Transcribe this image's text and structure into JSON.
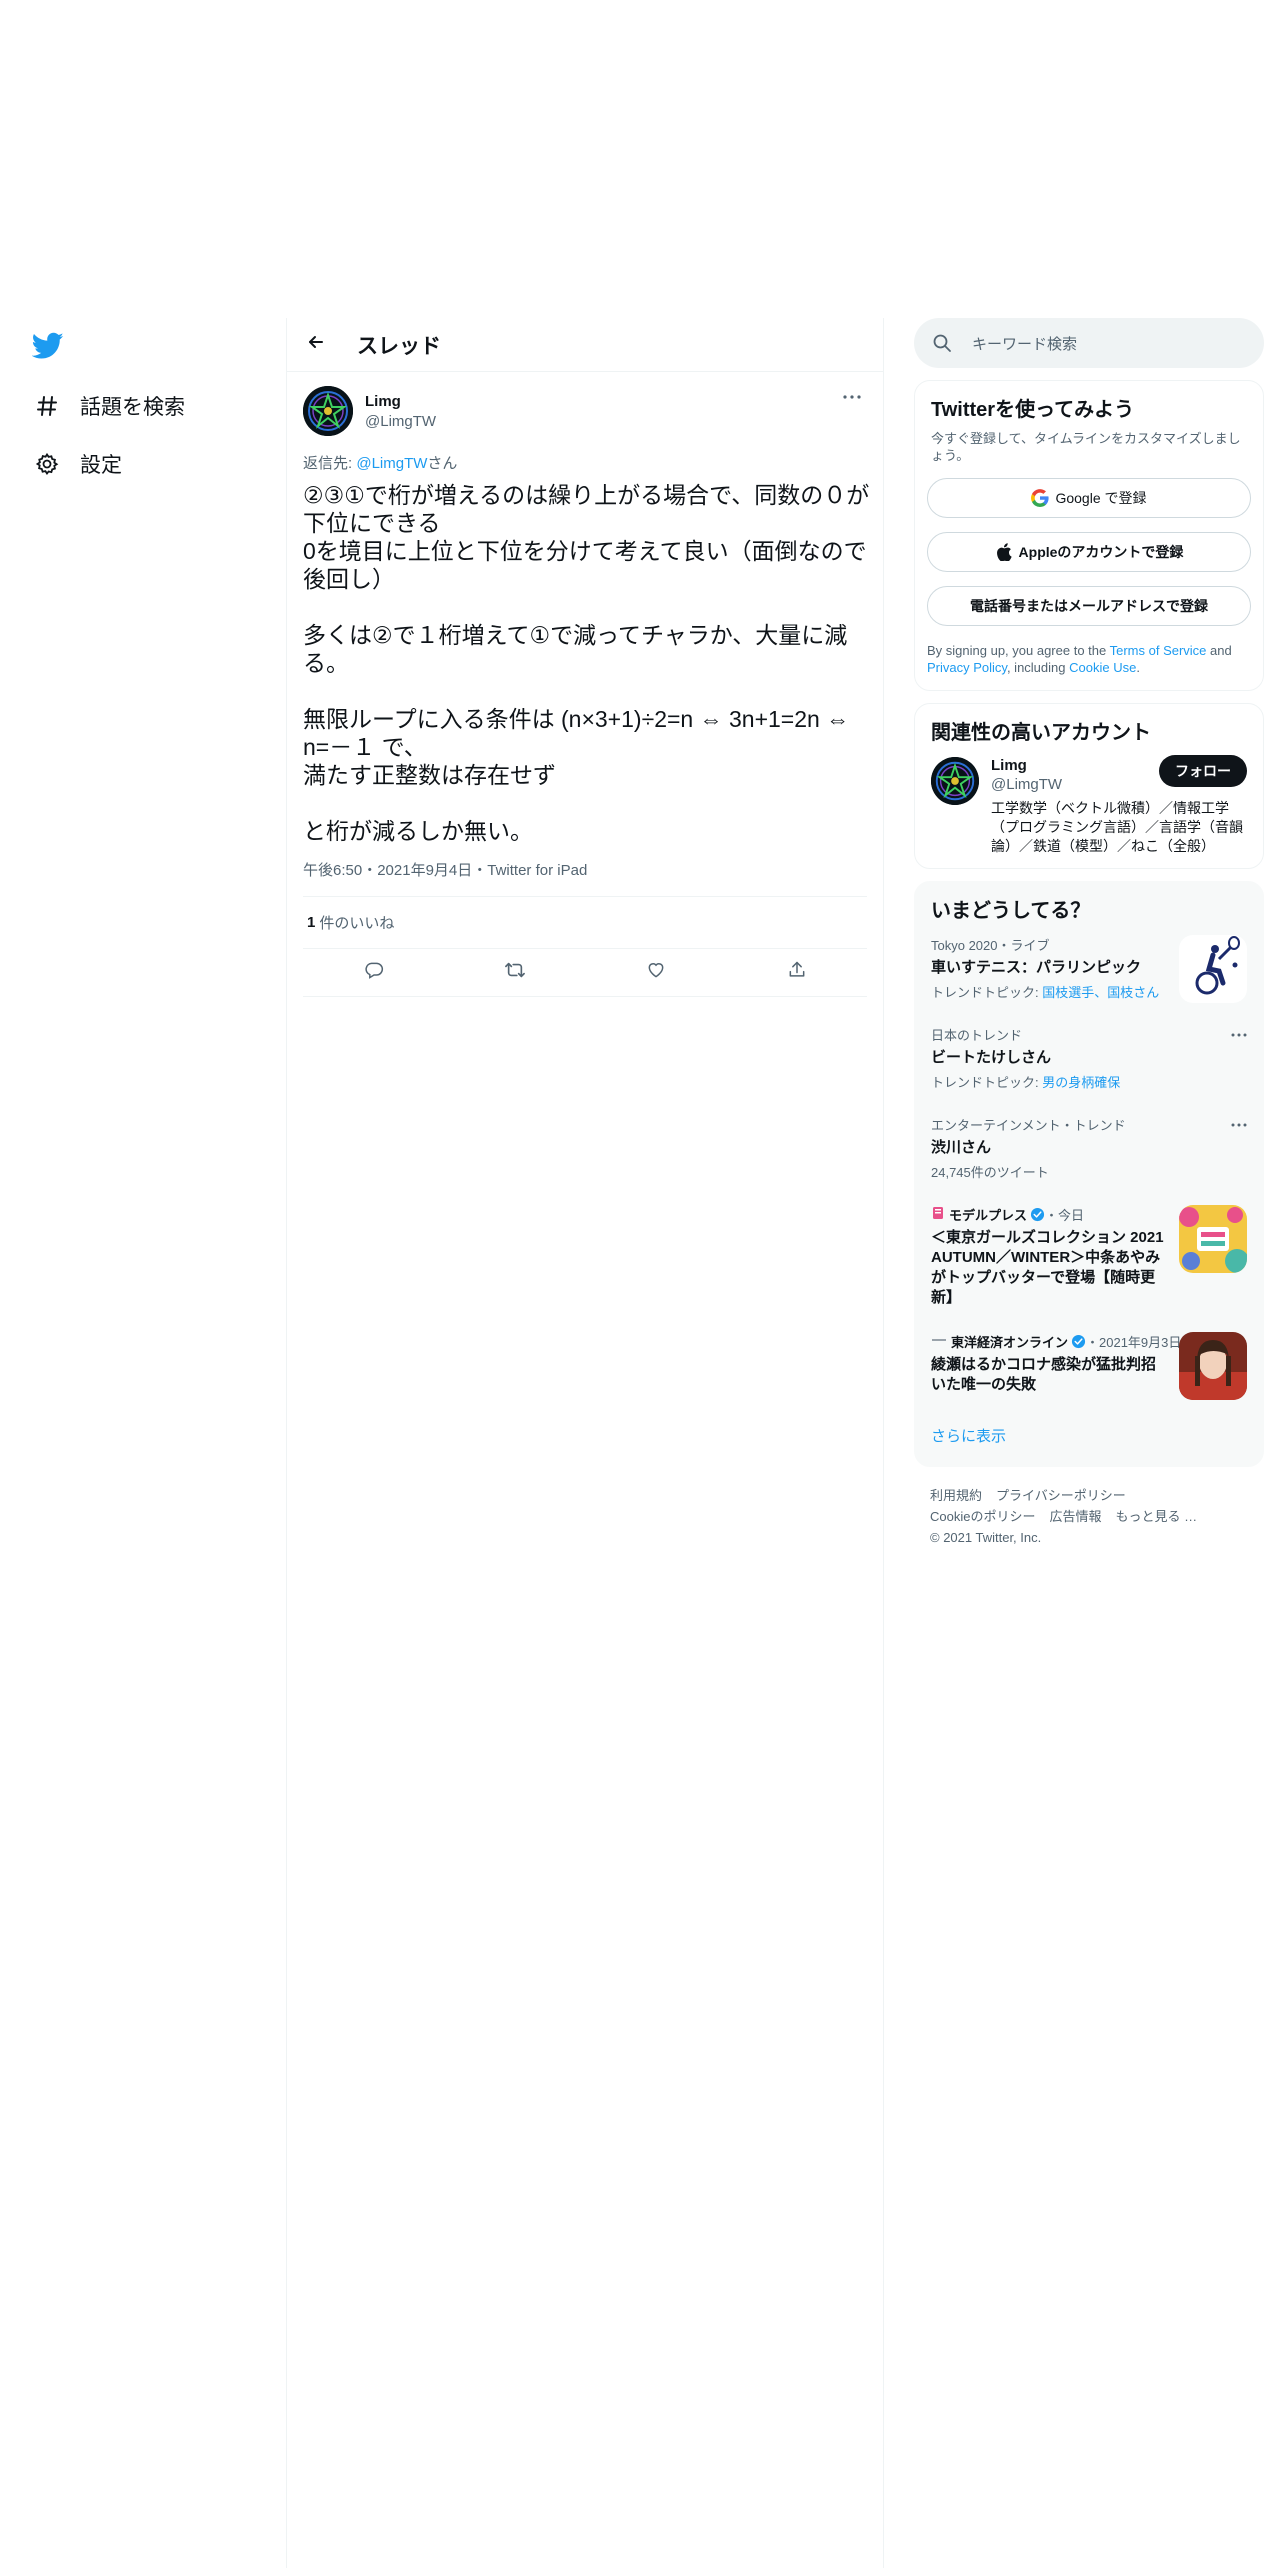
{
  "nav": {
    "explore_label": "話題を検索",
    "settings_label": "設定"
  },
  "thread": {
    "title": "スレッド"
  },
  "tweet": {
    "author_name": "Limg",
    "author_handle": "@LimgTW",
    "reply_prefix": "返信先: ",
    "reply_handle": "@LimgTW",
    "reply_suffix": "さん",
    "text": "②③①で桁が増えるのは繰り上がる場合で、同数の０が下位にできる\n0を境目に上位と下位を分けて考えて良い（面倒なので後回し）\n\n多くは②で１桁増えて①で減ってチャラか、大量に減る。\n\n無限ループに入る条件は (n×3+1)÷2=n ⇔ 3n+1=2n ⇔ n=－１ で、\n満たす正整数は存在せず\n\nと桁が減るしか無い。",
    "timestamp": "午後6:50・2021年9月4日・Twitter for iPad",
    "likes_count": "1",
    "likes_label": "件のいいね"
  },
  "search": {
    "placeholder": "キーワード検索"
  },
  "signup": {
    "title": "Twitterを使ってみよう",
    "subtitle": "今すぐ登録して、タイムラインをカスタマイズしましょう。",
    "google_label": "Google で登録",
    "apple_label": "Appleのアカウントで登録",
    "email_label": "電話番号またはメールアドレスで登録",
    "note_prefix": "By signing up, you agree to the ",
    "terms_link": "Terms of Service",
    "note_and": " and ",
    "privacy_link": "Privacy Policy",
    "note_including": ", including ",
    "cookie_link": "Cookie Use",
    "note_end": "."
  },
  "related": {
    "title": "関連性の高いアカウント",
    "name": "Limg",
    "handle": "@LimgTW",
    "follow_label": "フォロー",
    "bio": "工学数学（ベクトル微積）／情報工学（プログラミング言語）／言語学（音韻論）／鉄道（模型）／ねこ（全般）"
  },
  "trends": {
    "title": "いまどうしてる？",
    "items": [
      {
        "meta": "Tokyo 2020・ライブ",
        "title": "車いすテニス：パラリンピック",
        "sub_prefix": "トレンドトピック: ",
        "sub_link": "国枝選手、国枝さん"
      },
      {
        "meta": "日本のトレンド",
        "title": "ビートたけしさん",
        "sub_prefix": "トレンドトピック: ",
        "sub_link": "男の身柄確保"
      },
      {
        "meta": "エンターテインメント・トレンド",
        "title": "渋川さん",
        "sub": "24,745件のツイート"
      },
      {
        "source": "モデルプレス",
        "time": "・今日",
        "title": "＜東京ガールズコレクション 2021 AUTUMN／WINTER＞中条あやみがトップバッターで登場【随時更新】"
      },
      {
        "source": "東洋経済オンライン",
        "time": "・2021年9月3日",
        "title": "綾瀬はるかコロナ感染が猛批判招いた唯一の失敗"
      }
    ],
    "show_more": "さらに表示"
  },
  "footer": {
    "terms": "利用規約",
    "privacy": "プライバシーポリシー",
    "cookie": "Cookieのポリシー",
    "ads": "広告情報",
    "more": "もっと見る …",
    "copyright": "© 2021 Twitter, Inc."
  },
  "colors": {
    "brand": "#1d9bf0",
    "text": "#0f1419",
    "muted": "#536471",
    "border": "#eff3f4"
  }
}
